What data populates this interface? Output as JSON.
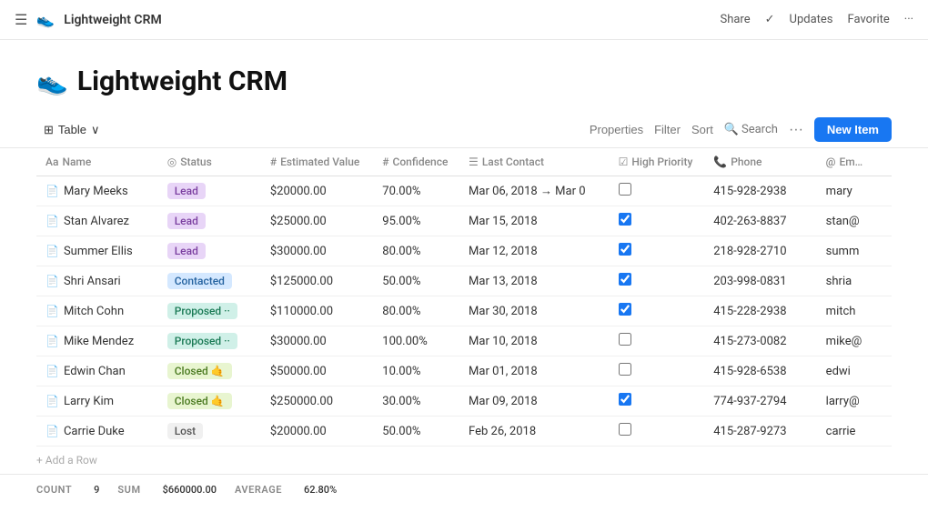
{
  "topbar": {
    "app_icon": "👟",
    "app_name": "Lightweight CRM",
    "share": "Share",
    "checkmark": "✓",
    "updates": "Updates",
    "favorite": "Favorite",
    "more": "···"
  },
  "header": {
    "icon": "👟",
    "title": "Lightweight CRM"
  },
  "toolbar": {
    "table_label": "Table",
    "chevron": "∨",
    "properties": "Properties",
    "filter": "Filter",
    "sort": "Sort",
    "search_icon": "🔍",
    "search": "Search",
    "dots": "···",
    "new_item": "New Item"
  },
  "columns": [
    {
      "icon": "Aa",
      "label": "Name"
    },
    {
      "icon": "◎",
      "label": "Status"
    },
    {
      "icon": "#",
      "label": "Estimated Value"
    },
    {
      "icon": "#",
      "label": "Confidence"
    },
    {
      "icon": "☰",
      "label": "Last Contact"
    },
    {
      "icon": "☑",
      "label": "High Priority"
    },
    {
      "icon": "📞",
      "label": "Phone"
    },
    {
      "icon": "@",
      "label": "Em..."
    }
  ],
  "rows": [
    {
      "name": "Mary Meeks",
      "status": "Lead",
      "status_type": "lead",
      "estimated": "$20000.00",
      "confidence": "70.00%",
      "last_contact": "Mar 06, 2018 → Mar 0",
      "high_priority": false,
      "phone": "415-928-2938",
      "email": "mary"
    },
    {
      "name": "Stan Alvarez",
      "status": "Lead",
      "status_type": "lead",
      "estimated": "$25000.00",
      "confidence": "95.00%",
      "last_contact": "Mar 15, 2018",
      "high_priority": true,
      "phone": "402-263-8837",
      "email": "stan@"
    },
    {
      "name": "Summer Ellis",
      "status": "Lead",
      "status_type": "lead",
      "estimated": "$30000.00",
      "confidence": "80.00%",
      "last_contact": "Mar 12, 2018",
      "high_priority": true,
      "phone": "218-928-2710",
      "email": "summ"
    },
    {
      "name": "Shri Ansari",
      "status": "Contacted",
      "status_type": "contacted",
      "estimated": "$125000.00",
      "confidence": "50.00%",
      "last_contact": "Mar 13, 2018",
      "high_priority": true,
      "phone": "203-998-0831",
      "email": "shria"
    },
    {
      "name": "Mitch Cohn",
      "status": "Proposed ··",
      "status_type": "proposed",
      "estimated": "$110000.00",
      "confidence": "80.00%",
      "last_contact": "Mar 30, 2018",
      "high_priority": true,
      "phone": "415-228-2938",
      "email": "mitch"
    },
    {
      "name": "Mike Mendez",
      "status": "Proposed ··",
      "status_type": "proposed",
      "estimated": "$30000.00",
      "confidence": "100.00%",
      "last_contact": "Mar 10, 2018",
      "high_priority": false,
      "phone": "415-273-0082",
      "email": "mike@"
    },
    {
      "name": "Edwin Chan",
      "status": "Closed 🤙",
      "status_type": "closed",
      "estimated": "$50000.00",
      "confidence": "10.00%",
      "last_contact": "Mar 01, 2018",
      "high_priority": false,
      "phone": "415-928-6538",
      "email": "edwi"
    },
    {
      "name": "Larry Kim",
      "status": "Closed 🤙",
      "status_type": "closed",
      "estimated": "$250000.00",
      "confidence": "30.00%",
      "last_contact": "Mar 09, 2018",
      "high_priority": true,
      "phone": "774-937-2794",
      "email": "larry@"
    },
    {
      "name": "Carrie Duke",
      "status": "Lost",
      "status_type": "lost",
      "estimated": "$20000.00",
      "confidence": "50.00%",
      "last_contact": "Feb 26, 2018",
      "high_priority": false,
      "phone": "415-287-9273",
      "email": "carrie"
    }
  ],
  "footer": {
    "add_row": "+ Add a Row"
  },
  "summary": {
    "count_label": "COUNT",
    "count_value": "9",
    "sum_label": "SUM",
    "sum_value": "$660000.00",
    "average_label": "AVERAGE",
    "average_value": "62.80%"
  }
}
